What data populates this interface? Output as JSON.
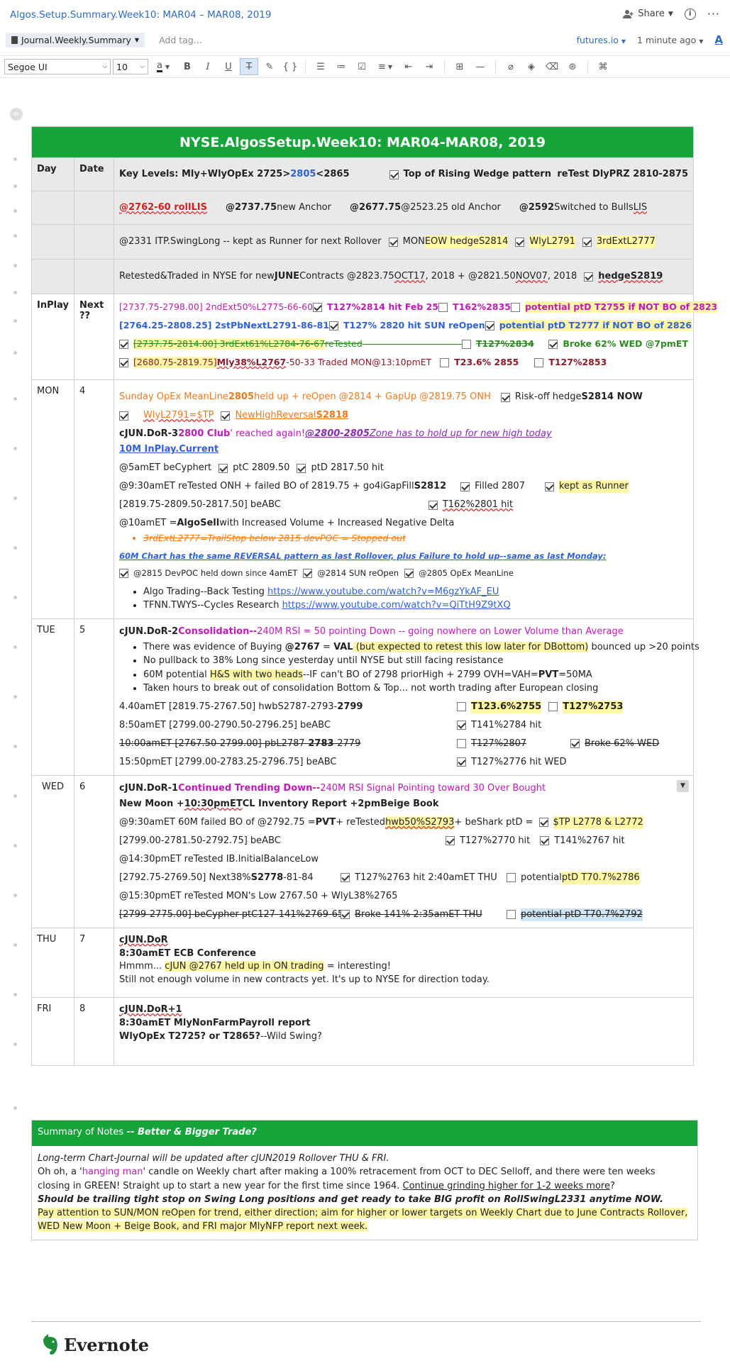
{
  "window": {
    "title": "Algos.Setup.Summary.Week10: MAR04 – MAR08, 2019",
    "share": "Share"
  },
  "notebar": {
    "notebook": "Journal.Weekly.Summary",
    "add_tag": "Add tag...",
    "site": "futures.io",
    "saved": "1 minute ago"
  },
  "toolbar": {
    "font": "Segoe UI",
    "size": "10"
  },
  "table": {
    "title": "NYSE.AlgosSetup.Week10: MAR04-MAR08, 2019",
    "h_day": "Day",
    "h_date": "Date",
    "kl_a": "Key Levels:  Mly+WlyOpEx 2725>",
    "kl_b": "2805",
    "kl_c": "<2865",
    "kl_d": "Top of Rising Wedge pattern",
    "kl_e": "reTest DlyPRZ 2810-2875",
    "r2a": "@2762-60 rollLIS",
    "r2b": "@2737.75",
    "r2c": " new Anchor",
    "r2d": "@2677.75",
    "r2e": " @2523.25 old Anchor",
    "r2f": "@2592",
    "r2g": " Switched to Bulls ",
    "r2h": "LIS",
    "r3a": "@2331 ITP.SwingLong -- kept as Runner for next Rollover",
    "r3b": "MON ",
    "r3c": "EOW hedgeS2814",
    "r3d": "WlyL2791",
    "r3e": "3rdExtL2777",
    "r4a": "Retested&Traded in NYSE for new ",
    "r4b": "JUNE",
    "r4c": " Contracts @2823.75 ",
    "r4d": "OCT17",
    "r4e": ", 2018  + @2821.50 ",
    "r4f": "NOV07",
    "r4g": ", 2018",
    "r4h": "hedgeS2819",
    "inplay": "InPlay",
    "next": "Next ??",
    "ip1a": "[2737.75-2798.00] 2ndExt50%L2775-66-60",
    "ip1b": "T127%2814 hit Feb 25",
    "ip1c": "T162%2835",
    "ip1d": "potential ptD T2755 if NOT BO of 2823",
    "ip2a": "[2764.25-2808.25] 2stPbNextL2791-86-81",
    "ip2b": "T127% 2820 hit SUN reOpen",
    "ip2c": "potential ptD T2777 if NOT BO of 2826",
    "ip3a": "[2737.75-2814.00] 3rdExt61%L2784-76-67",
    "ip3b": " reTested",
    "ip3c": "T127%2834",
    "ip3d": "Broke 62% WED @7pmET",
    "ip4a": "[2680.75-2819.75] ",
    "ip4b": "Mly38%L2767",
    "ip4c": "-50-33  Traded MON@13:10pmET",
    "ip4d": "T23.6% 2855",
    "ip4e": "T127%2853",
    "mon_day": "MON",
    "mon_date": "4",
    "m1a": "Sunday OpEx MeanLine ",
    "m1b": "2805",
    "m1c": " held up + reOpen @2814 + GapUp @2819.75 ONH",
    "m1d": "Risk-off hedge",
    "m1e": "S2814 NOW",
    "m2a": "WlyL2791=$TP",
    "m2b": "NewHighReversal",
    "m2c": "S2818",
    "m3a": "cJUN.DoR-3 ",
    "m3b": " 2800 Club",
    "m3c": "' reached again! ",
    "m3d": "@2800-2805",
    "m3e": " Zone has to hold up for new high today",
    "m4": "10M InPlay.Current",
    "m5a": "@5amET beCyphert",
    "m5b": "ptC 2809.50",
    "m5c": "ptD 2817.50 hit",
    "m6a": "@9:30amET reTested ONH + failed BO of 2819.75  + go4iGapFill",
    "m6b": "S2812",
    "m6c": "Filled 2807",
    "m6d": "kept as Runner",
    "m7a": "[2819.75-2809.50-2817.50] beABC",
    "m7b": "T162%2801 hit",
    "m8a": "@10amET  = ",
    "m8b": "AlgoSell",
    "m8c": " with Increased Volume  + Increased Negative Delta",
    "m9": "3rdExtL2777=TrailStop below 2815 devPOC = Stopped out",
    "m10": "60M Chart has the same REVERSAL pattern as last Rollover, plus Failure to hold up--same as last Monday:",
    "m11a": "@2815 DevPOC held down since 4amET",
    "m11b": "@2814 SUN reOpen",
    "m11c": "@2805 OpEx MeanLine",
    "m12a": "Algo Trading--Back Testing  ",
    "m12b": "https://www.youtube.com/watch?v=M6gzYkAF_EU",
    "m13a": "TFNN.TWYS--Cycles Research  ",
    "m13b": "https://www.youtube.com/watch?v=QiTtH9Z9tXQ",
    "tue_day": "TUE",
    "tue_date": "5",
    "t1a": "cJUN.DoR-2 ",
    "t1b": "Consolidation--",
    "t1c": "240M RSI = 50 pointing Down -- going nowhere on Lower Volume than Average",
    "t2a": "There was evidence of Buying ",
    "t2b": "@2767",
    "t2c": " = ",
    "t2d": "VAL",
    "t2e": " (but expected to retest this low later for DBottom)",
    "t2f": " bounced up >20 points",
    "t3": "No pullback to 38% Long since yesterday until NYSE but still facing resistance",
    "t4a": "60M potential ",
    "t4b": "H&S with two heads",
    "t4c": "--IF can't BO of 2798 priorHigh + 2799 OVH=VAH=",
    "t4d": "PVT",
    "t4e": "=50MA",
    "t5": "Taken hours to break out of consolidation Bottom & Top... not worth trading after European closing",
    "t6a": "4.40amET [2819.75-2767.50] hwbS2787-2793-",
    "t6b": "2799",
    "t6c": "T123.6%2755",
    "t6d": "T127%2753",
    "t7a": "8:50amET [2799.00-2790.50-2796.25] beABC",
    "t7b": "T141%2784 hit",
    "t8a": "10:00amET [2767.50-2799.00] pbL2787-",
    "t8b": "2783",
    "t8c": "-2779",
    "t8d": "T127%2807",
    "t8e": "Broke 62% WED",
    "t9a": "15:50pmET [2799.00-2783.25-2796.75] beABC",
    "t9b": "T127%2776 hit WED",
    "wed_day": "WED",
    "wed_date": "6",
    "w1a": "cJUN.DoR-1 ",
    "w1b": "Continued Trending Down--",
    "w1c": "240M RSI Signal Pointing toward 30 Over Bought",
    "w2a": "New Moon + ",
    "w2b": "10:30pmET",
    "w2c": " CL Inventory Report + ",
    "w2d": "2pm",
    "w2e": " Beige Book",
    "w3a": "@9:30amET 60M failed BO of @2792.75 = ",
    "w3b": "PVT",
    "w3c": " + reTested ",
    "w3d": "hwb50%S2793",
    "w3e": " + beShark ptD   =",
    "w3f": "$TP L2778 & L2772",
    "w4a": "[2799.00-2781.50-2792.75] beABC",
    "w4b": "T127%2770 hit",
    "w4c": "T141%2767 hit",
    "w5": "@14:30pmET reTested IB.InitialBalanceLow",
    "w6a": "[2792.75-2769.50] Next38%",
    "w6b": "S2778",
    "w6c": "-81-84",
    "w6d": "T127%2763 hit 2:40amET THU",
    "w6e": "potential ",
    "w6f": "ptD T70.7%2786",
    "w7": "@15:30pmET reTested MON's Low 2767.50 + WlyL38%2765",
    "w8a": "[2799-2775.00] beCypher ptC127-141%2769-65",
    "w8b": "Broke 141% 2:35amET THU",
    "w8c": "potential ptD T70.7%2792",
    "thu_day": "THU",
    "thu_date": "7",
    "th1": "cJUN.DoR",
    "th2": "8:30amET ECB Conference",
    "th3a": "Hmmm... ",
    "th3b": "cJUN @2767 held up in ON trading",
    "th3c": " = interesting!",
    "th4": "Still not enough volume in new contracts yet.  It's up to NYSE for direction today.",
    "fri_day": "FRI",
    "fri_date": "8",
    "f1": "cJUN.DoR+1",
    "f2": "8:30amET MlyNonFarmPayroll report",
    "f3a": "WlyOpEx T2725? or T2865?",
    "f3b": "--Wild Swing?"
  },
  "summary": {
    "head_a": "Summary of Notes",
    "head_b": "  -- Better & Bigger Trade?",
    "l1": "Long-term Chart-Journal will be updated after cJUN2019 Rollover THU & FRI.",
    "l2a": "Oh oh, a '",
    "l2b": "hanging man",
    "l2c": "' candle on Weekly chart after making a 100% retracement from OCT to DEC Selloff, and there were ten weeks",
    "l3a": "closing in GREEN!  Straight up to start a new year for the first time since 1964.  ",
    "l3b": "Continue grinding higher for 1-2 weeks more",
    "l4": "Should be trailing tight stop on Swing Long positions and get ready to take BIG profit on RollSwingL2331 anytime NOW.",
    "l5": "Pay attention to SUN/MON reOpen for trend, either direction; aim for higher or lower targets on Weekly Chart due to June Contracts Rollover,",
    "l6": "WED New Moon + Beige Book, and FRI major MlyNFP report next week."
  },
  "footer": {
    "brand": "Evernote"
  }
}
